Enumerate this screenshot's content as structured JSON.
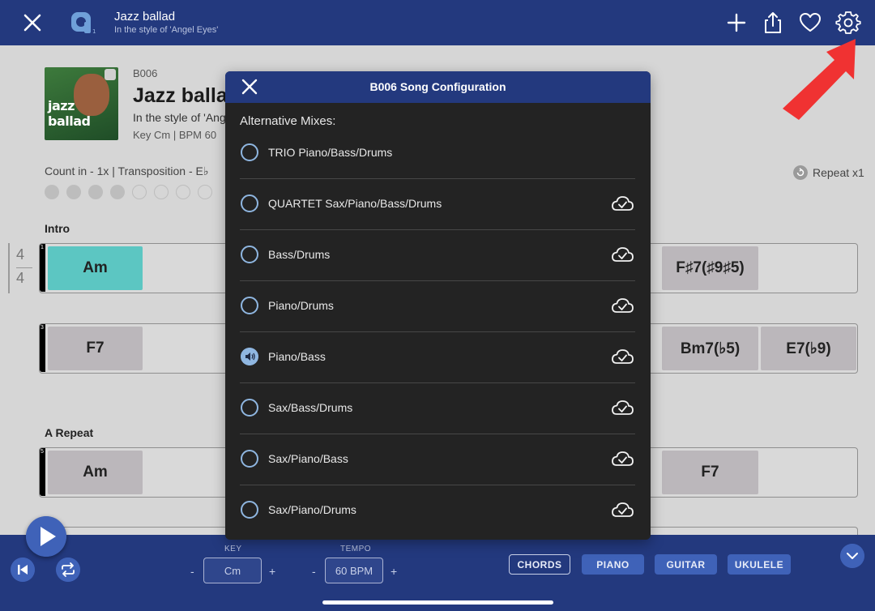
{
  "header": {
    "title": "Jazz ballad",
    "subtitle": "In the style of 'Angel Eyes'",
    "icons": [
      "close-icon",
      "app-logo-icon",
      "add-icon",
      "share-icon",
      "favorite-heart-icon",
      "settings-gear-icon"
    ]
  },
  "song": {
    "code": "B006",
    "title": "Jazz ballad",
    "style_line": "In the style of 'Angel Eyes'",
    "key_bpm": "Key Cm | BPM 60",
    "album_text": "jazz ballad",
    "count_in": "Count in - 1x | Transposition - E♭",
    "repeat": "Repeat x1"
  },
  "sheet": {
    "time_signature": {
      "top": "4",
      "bottom": "4"
    },
    "sections": [
      {
        "label": "Intro"
      },
      {
        "label": "A Repeat"
      }
    ],
    "rows": [
      {
        "bar": "1",
        "left": [
          "Am",
          ""
        ],
        "right": [
          "F♯7(♯9♯5)",
          ""
        ]
      },
      {
        "bar": "3",
        "left": [
          "F7",
          ""
        ],
        "right": [
          "Bm7(♭5)",
          "E7(♭9)"
        ]
      },
      {
        "bar": "5",
        "left": [
          "Am",
          ""
        ],
        "right": [
          "F7",
          ""
        ]
      }
    ]
  },
  "modal": {
    "title": "B006 Song Configuration",
    "section_label": "Alternative Mixes:",
    "options": [
      {
        "label": "TRIO Piano/Bass/Drums",
        "selected": false,
        "cloud": false
      },
      {
        "label": "QUARTET Sax/Piano/Bass/Drums",
        "selected": false,
        "cloud": true
      },
      {
        "label": "Bass/Drums",
        "selected": false,
        "cloud": true
      },
      {
        "label": "Piano/Drums",
        "selected": false,
        "cloud": true
      },
      {
        "label": "Piano/Bass",
        "selected": true,
        "cloud": true
      },
      {
        "label": "Sax/Bass/Drums",
        "selected": false,
        "cloud": true
      },
      {
        "label": "Sax/Piano/Bass",
        "selected": false,
        "cloud": true
      },
      {
        "label": "Sax/Piano/Drums",
        "selected": false,
        "cloud": true
      }
    ]
  },
  "controls": {
    "key_label": "KEY",
    "key_value": "Cm",
    "tempo_label": "TEMPO",
    "tempo_value": "60 BPM",
    "minus": "-",
    "plus": "+",
    "tabs": [
      "CHORDS",
      "PIANO",
      "GUITAR",
      "UKULELE"
    ],
    "active_tab": "CHORDS"
  },
  "colors": {
    "bar_blue": "#23397e",
    "button_blue": "#3f62b8",
    "active_chord": "#5cc6c2",
    "radio_accent": "#8fb6e0",
    "annotation_arrow": "#f03232"
  }
}
